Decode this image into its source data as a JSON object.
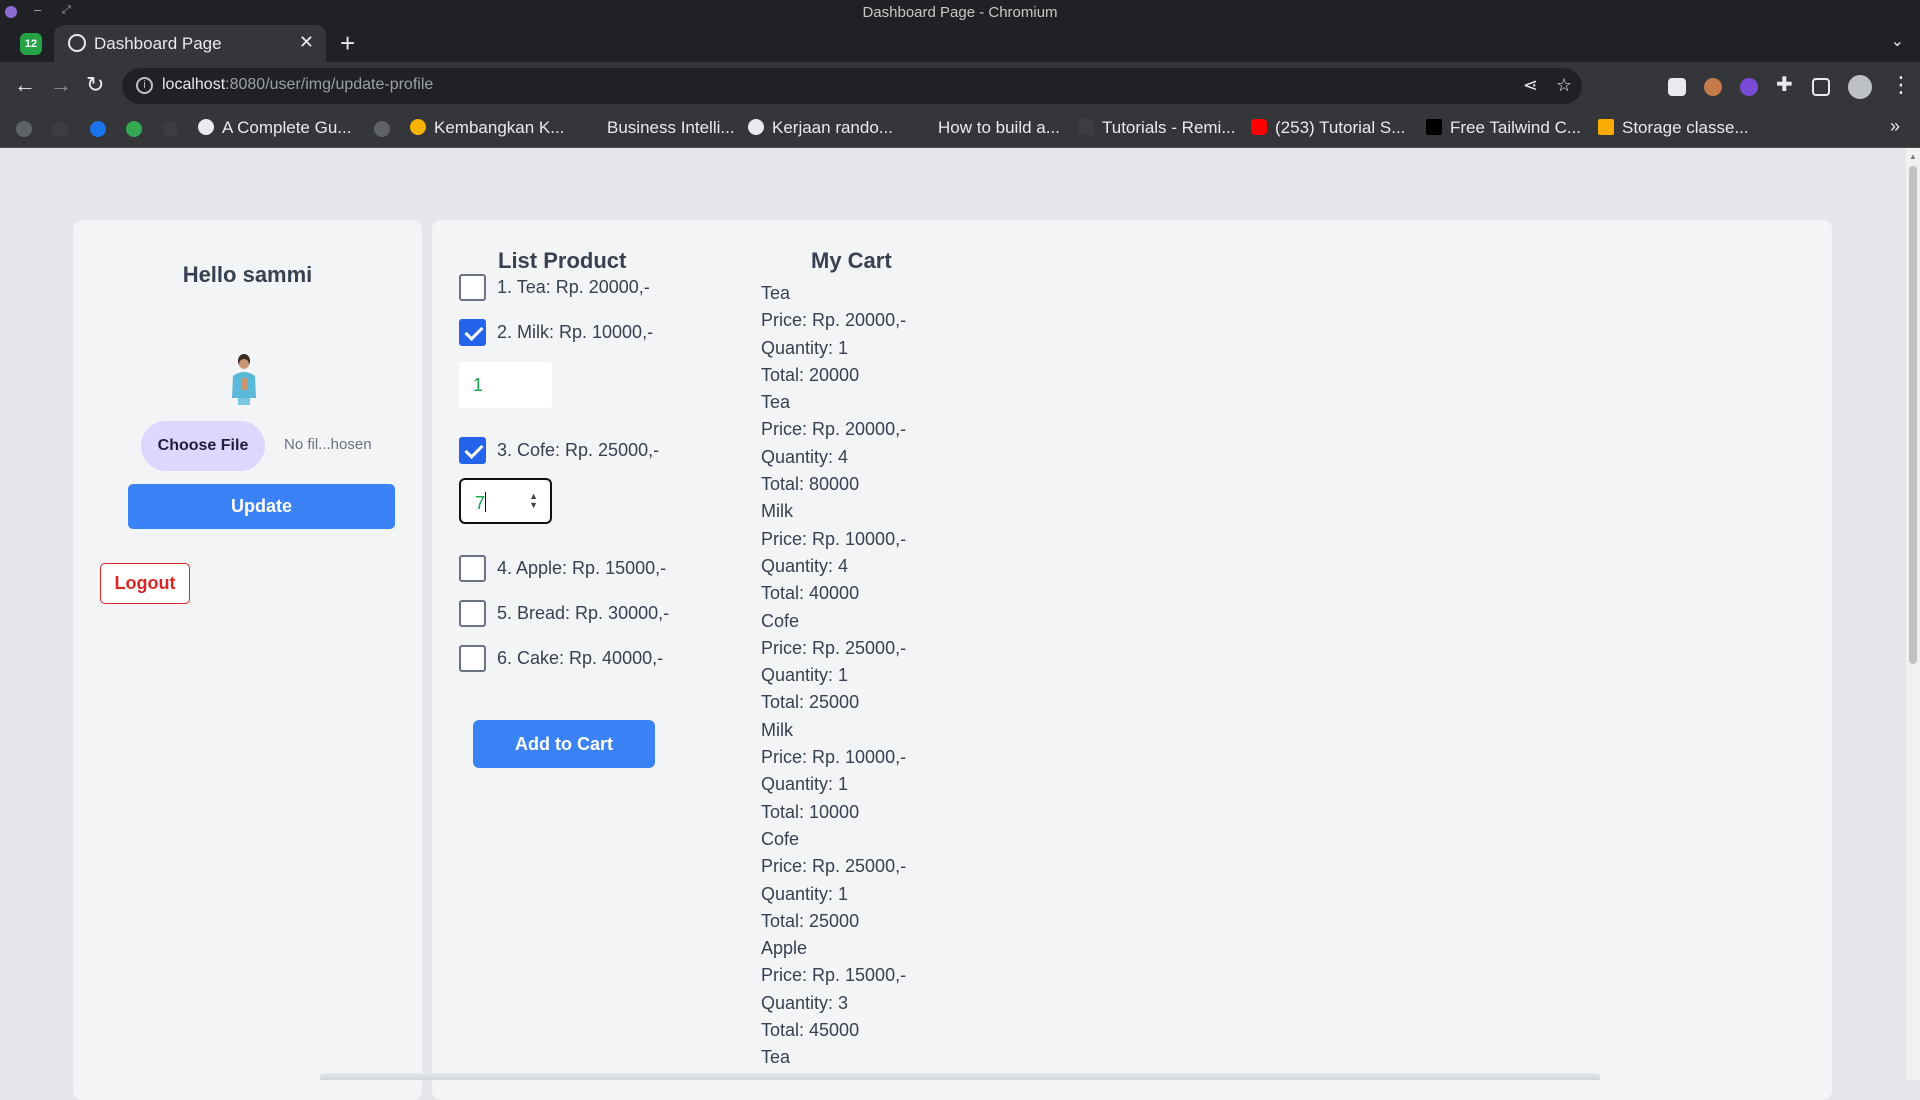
{
  "window": {
    "title": "Dashboard Page - Chromium"
  },
  "tab": {
    "title": "Dashboard Page",
    "whatsapp_badge": "12"
  },
  "address": {
    "host": "localhost",
    "path": ":8080/user/img/update-profile"
  },
  "bookmarks": [
    "A Complete Gu...",
    "Kembangkan K...",
    "Business Intelli...",
    "Kerjaan rando...",
    "How to build a...",
    "Tutorials - Remi...",
    "(253) Tutorial S...",
    "Free Tailwind C...",
    "Storage classe..."
  ],
  "profile": {
    "greeting": "Hello sammi",
    "choose_file": "Choose File",
    "no_file": "No fil...hosen",
    "update": "Update",
    "logout": "Logout"
  },
  "products": {
    "heading": "List Product",
    "items": [
      {
        "label": "1. Tea: Rp. 20000,-",
        "checked": false
      },
      {
        "label": "2. Milk: Rp. 10000,-",
        "checked": true,
        "quantity": "1"
      },
      {
        "label": "3. Cofe: Rp. 25000,-",
        "checked": true,
        "quantity": "7"
      },
      {
        "label": "4. Apple: Rp. 15000,-",
        "checked": false
      },
      {
        "label": "5. Bread: Rp. 30000,-",
        "checked": false
      },
      {
        "label": "6. Cake: Rp. 40000,-",
        "checked": false
      }
    ],
    "add_to_cart": "Add to Cart"
  },
  "cart": {
    "heading": "My Cart",
    "items": [
      {
        "name": "Tea",
        "price": "Price: Rp. 20000,-",
        "quantity": "Quantity: 1",
        "total": "Total: 20000"
      },
      {
        "name": "Tea",
        "price": "Price: Rp. 20000,-",
        "quantity": "Quantity: 4",
        "total": "Total: 80000"
      },
      {
        "name": "Milk",
        "price": "Price: Rp. 10000,-",
        "quantity": "Quantity: 4",
        "total": "Total: 40000"
      },
      {
        "name": "Cofe",
        "price": "Price: Rp. 25000,-",
        "quantity": "Quantity: 1",
        "total": "Total: 25000"
      },
      {
        "name": "Milk",
        "price": "Price: Rp. 10000,-",
        "quantity": "Quantity: 1",
        "total": "Total: 10000"
      },
      {
        "name": "Cofe",
        "price": "Price: Rp. 25000,-",
        "quantity": "Quantity: 1",
        "total": "Total: 25000"
      },
      {
        "name": "Apple",
        "price": "Price: Rp. 15000,-",
        "quantity": "Quantity: 3",
        "total": "Total: 45000"
      },
      {
        "name": "Tea"
      }
    ]
  },
  "colors": {
    "primary": "#3b82f6",
    "danger": "#dc2626",
    "file_button": "#ddd6fe",
    "quantity_text": "#16a34a"
  }
}
